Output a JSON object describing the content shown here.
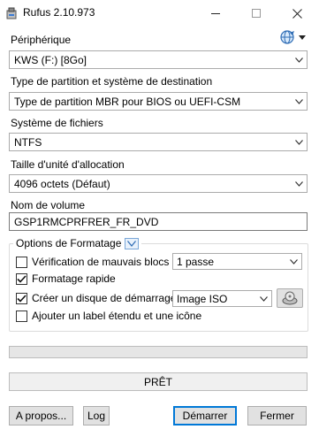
{
  "window": {
    "title": "Rufus 2.10.973"
  },
  "device": {
    "label": "Périphérique",
    "value": "KWS (F:) [8Go]"
  },
  "partition": {
    "label": "Type de partition et système de destination",
    "value": "Type de partition MBR pour BIOS ou UEFI-CSM"
  },
  "filesystem": {
    "label": "Système de fichiers",
    "value": "NTFS"
  },
  "cluster": {
    "label": "Taille d'unité d'allocation",
    "value": "4096 octets (Défaut)"
  },
  "volume": {
    "label": "Nom de volume",
    "value": "GSP1RMCPRFRER_FR_DVD"
  },
  "format_options": {
    "title": "Options de Formatage",
    "bad_blocks": {
      "label": "Vérification de mauvais blocs",
      "checked": false,
      "passes": "1 passe"
    },
    "quick_format": {
      "label": "Formatage rapide",
      "checked": true
    },
    "bootable": {
      "label": "Créer un disque de démarrage",
      "checked": true,
      "type": "Image ISO"
    },
    "extended_label": {
      "label": "Ajouter un label étendu et une icône",
      "checked": false
    }
  },
  "status": {
    "text": "PRÊT"
  },
  "buttons": {
    "about": "A propos...",
    "log": "Log",
    "start": "Démarrer",
    "close": "Fermer"
  },
  "icons": {
    "app": "usb-drive-icon",
    "language": "globe-icon",
    "iso": "disc-drive-icon"
  }
}
